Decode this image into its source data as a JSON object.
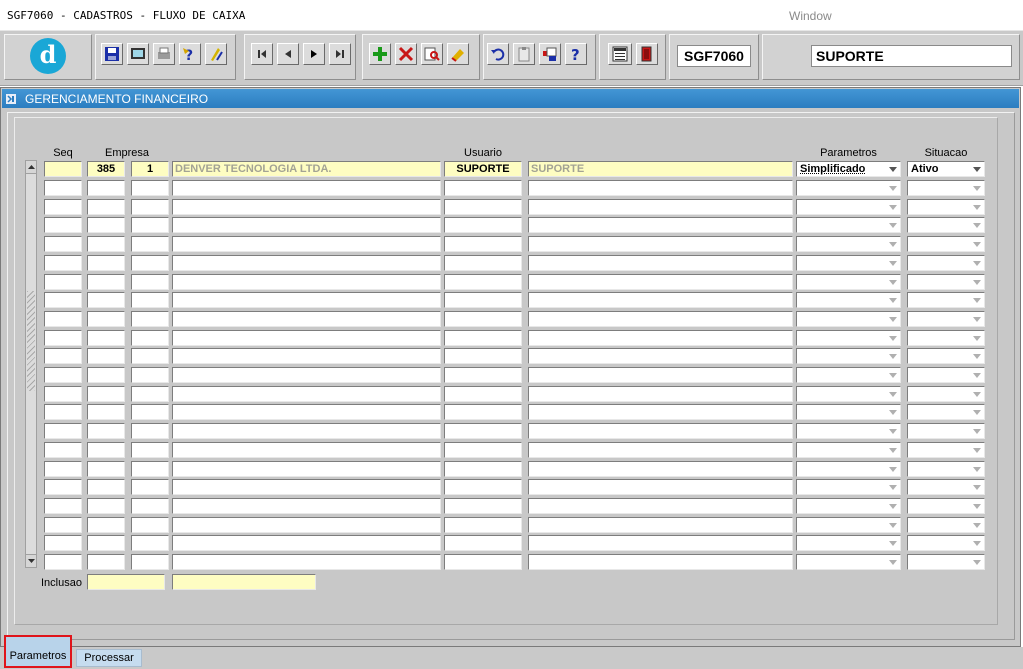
{
  "titlebar": {
    "title": "SGF7060 - CADASTROS - FLUXO DE CAIXA",
    "window_menu": "Window"
  },
  "toolbar": {
    "logo_letter": "d",
    "form_code": "SGF7060",
    "user": "SUPORTE",
    "icons": [
      "save-icon",
      "screen-icon",
      "print-icon",
      "query-help-icon",
      "execute-query-icon",
      "first-record-icon",
      "previous-record-icon",
      "next-record-icon",
      "last-record-icon",
      "insert-record-icon",
      "delete-record-icon",
      "search-icon",
      "clear-icon",
      "undo-icon",
      "clipboard-icon",
      "keys-icon",
      "help-icon",
      "menu-icon",
      "exit-icon"
    ]
  },
  "window": {
    "title": "GERENCIAMENTO FINANCEIRO"
  },
  "grid": {
    "headers": {
      "seq": "Seq",
      "empresa": "Empresa",
      "usuario": "Usuario",
      "parametros": "Parametros",
      "situacao": "Situacao"
    },
    "rows": [
      {
        "seq": "",
        "empresa_code": "385",
        "empresa_num": "1",
        "empresa_name": "DENVER TECNOLOGIA LTDA.",
        "usuario": "SUPORTE",
        "usuario_name": "SUPORTE",
        "parametros": "Simplificado",
        "situacao": "Ativo"
      }
    ],
    "empty_rows": 21
  },
  "footer": {
    "inclusao_label": "Inclusao",
    "inclusao_date": "",
    "inclusao_user": ""
  },
  "tabs": [
    {
      "label": "Parametros",
      "active": true
    },
    {
      "label": "Processar",
      "active": false
    }
  ],
  "colors": {
    "titlebar_blue": "#2b7dc0",
    "highlight_yellow": "#fefdc2",
    "active_tab_border": "#e0141a"
  }
}
